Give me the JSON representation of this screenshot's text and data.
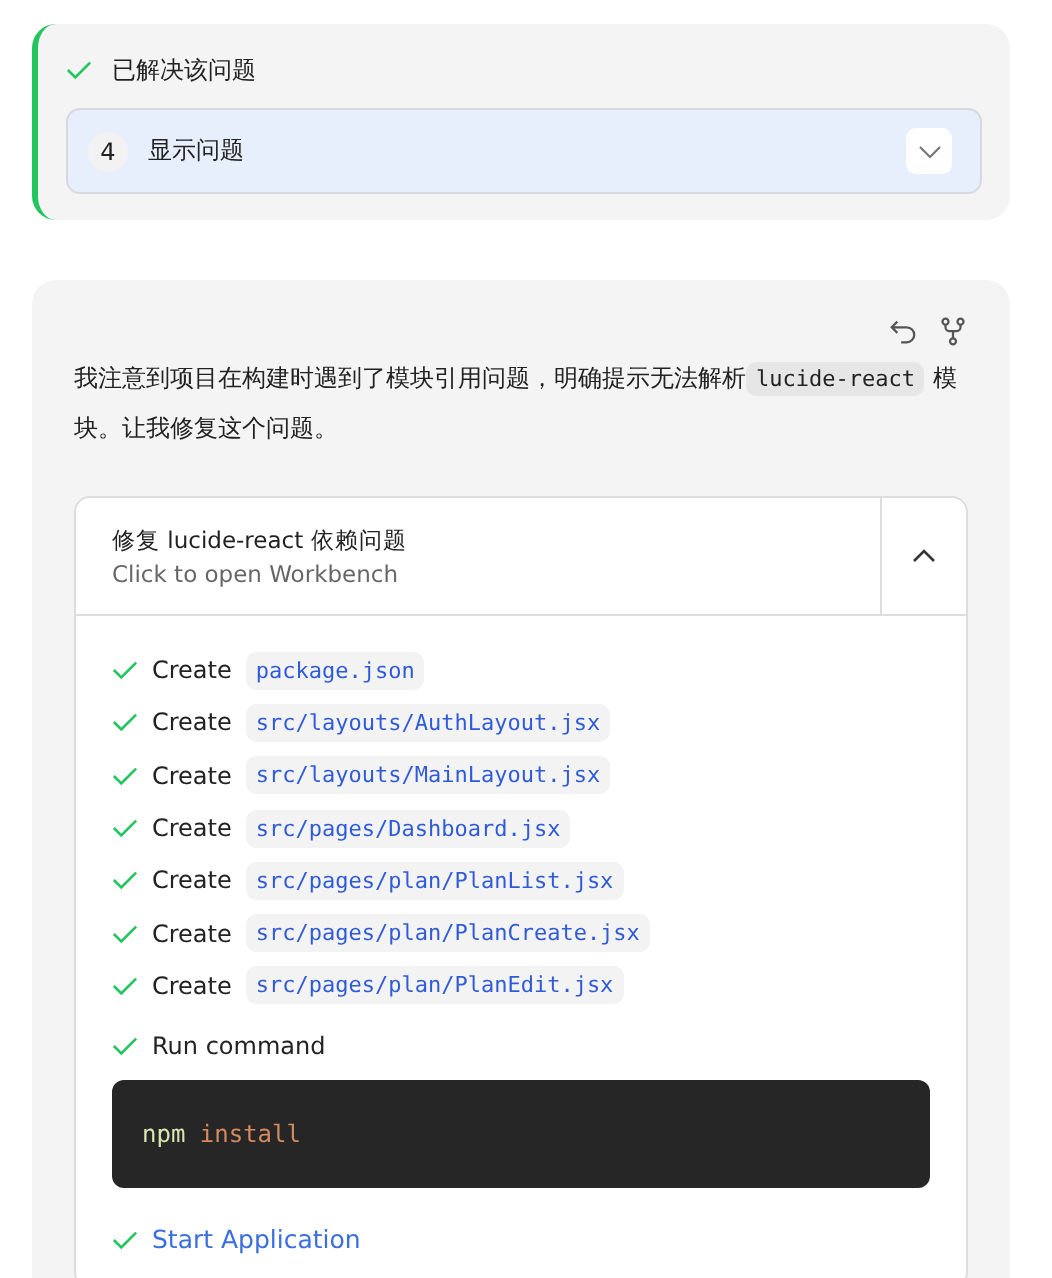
{
  "status_card": {
    "resolved": true,
    "label": "已解决该问题",
    "issue": {
      "number": "4",
      "label": "显示问题",
      "expanded": false
    }
  },
  "message": {
    "text_before": "我注意到项目在构建时遇到了模块引用问题，明确提示无法解析",
    "code": "lucide-react",
    "text_after": "模块。让我修复这个问题。",
    "workbench": {
      "title": "修复 lucide-react 依赖问题",
      "subtitle": "Click to open Workbench",
      "expanded": true,
      "steps": [
        {
          "kind": "file",
          "done": true,
          "action": "Create",
          "path": "package.json"
        },
        {
          "kind": "file",
          "done": true,
          "action": "Create",
          "path": "src/layouts/AuthLayout.jsx"
        },
        {
          "kind": "file",
          "done": true,
          "action": "Create",
          "path": "src/layouts/MainLayout.jsx"
        },
        {
          "kind": "file",
          "done": true,
          "action": "Create",
          "path": "src/pages/Dashboard.jsx"
        },
        {
          "kind": "file",
          "done": true,
          "action": "Create",
          "path": "src/pages/plan/PlanList.jsx"
        },
        {
          "kind": "file",
          "done": true,
          "action": "Create",
          "path": "src/pages/plan/PlanCreate.jsx"
        },
        {
          "kind": "file",
          "done": true,
          "action": "Create",
          "path": "src/pages/plan/PlanEdit.jsx"
        },
        {
          "kind": "command",
          "done": true,
          "action": "Run command",
          "program": "npm",
          "args": "install"
        },
        {
          "kind": "link",
          "done": true,
          "action": "Start Application"
        }
      ]
    }
  }
}
